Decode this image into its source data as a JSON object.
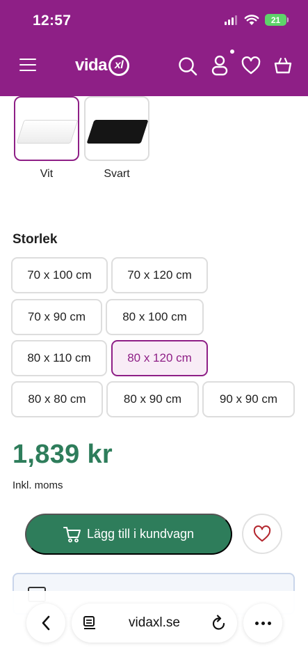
{
  "status_bar": {
    "time": "12:57",
    "battery": "21",
    "icons": [
      "signal-icon",
      "wifi-icon",
      "battery-icon"
    ]
  },
  "header": {
    "logo_text": "vida",
    "logo_mark": "xl",
    "icons": [
      "menu-icon",
      "search-icon",
      "user-icon",
      "heart-icon",
      "basket-icon"
    ],
    "background": "#8e1f86"
  },
  "colors": {
    "options": [
      {
        "label": "Vit",
        "selected": true
      },
      {
        "label": "Svart",
        "selected": false
      }
    ]
  },
  "size": {
    "title": "Storlek",
    "options": [
      {
        "label": "70 x 100 cm",
        "selected": false
      },
      {
        "label": "70 x 120 cm",
        "selected": false
      },
      {
        "label": "70 x 90 cm",
        "selected": false
      },
      {
        "label": "80 x 100 cm",
        "selected": false
      },
      {
        "label": "80 x 110 cm",
        "selected": false
      },
      {
        "label": "80 x 120 cm",
        "selected": true
      },
      {
        "label": "80 x 80 cm",
        "selected": false
      },
      {
        "label": "80 x 90 cm",
        "selected": false
      },
      {
        "label": "90 x 90 cm",
        "selected": false
      }
    ]
  },
  "price": {
    "amount": "1,839 kr",
    "vat_note": "Inkl. moms",
    "color": "#2e7d5b"
  },
  "actions": {
    "add_to_cart": "Lägg till i kundvagn",
    "cart_icon": "cart-icon",
    "wishlist_icon": "heart-icon"
  },
  "browser": {
    "domain": "vidaxl.se",
    "icons": [
      "back-icon",
      "reader-icon",
      "reload-icon",
      "more-icon"
    ]
  },
  "theme": {
    "primary": "#8e1f86",
    "accent_green": "#2e7d5b"
  }
}
